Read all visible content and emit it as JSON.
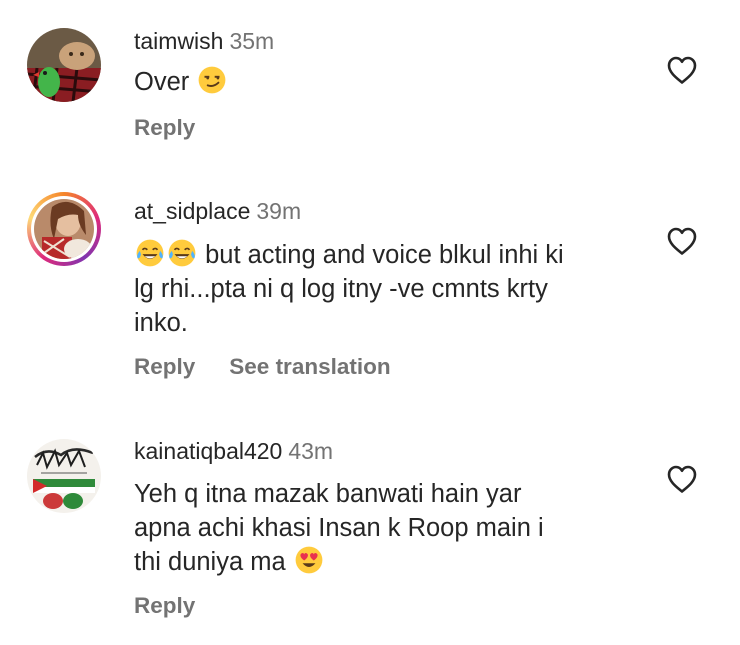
{
  "comments": [
    {
      "username": "taimwish",
      "time": "35m",
      "text": "Over",
      "emoji_suffix": "smirk",
      "reply_label": "Reply"
    },
    {
      "username": "at_sidplace",
      "time": "39m",
      "emoji_prefix": "laughing-tears x2",
      "text_line1": "but acting and voice blkul inhi ki",
      "text_line2": "lg rhi...pta ni q log itny -ve cmnts krty",
      "text_line3": "inko.",
      "reply_label": "Reply",
      "translate_label": "See translation"
    },
    {
      "username": "kainatiqbal420",
      "time": "43m",
      "text_line1": "Yeh q itna mazak banwati hain yar",
      "text_line2": "apna achi khasi Insan k Roop main i",
      "text_line3": "thi duniya ma",
      "emoji_suffix": "heart-eyes",
      "reply_label": "Reply"
    }
  ],
  "colors": {
    "text": "#262626",
    "muted": "#737373",
    "story_ring": [
      "#f58529",
      "#dd2a7b",
      "#8134af"
    ]
  }
}
